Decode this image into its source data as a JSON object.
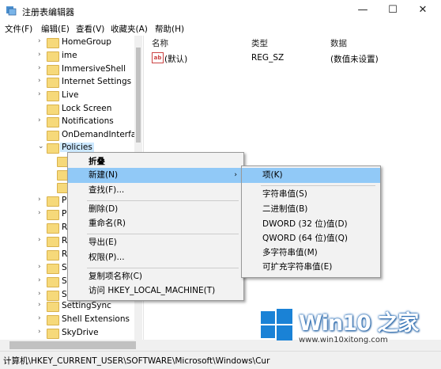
{
  "window": {
    "title": "注册表编辑器",
    "minimize": "—",
    "maximize": "☐",
    "close": "✕"
  },
  "menubar": [
    "文件(F)",
    "编辑(E)",
    "查看(V)",
    "收藏夹(A)",
    "帮助(H)"
  ],
  "tree": {
    "items": [
      {
        "label": "HomeGroup",
        "expanded": false
      },
      {
        "label": "ime",
        "expanded": false
      },
      {
        "label": "ImmersiveShell",
        "expanded": false
      },
      {
        "label": "Internet Settings",
        "expanded": false
      },
      {
        "label": "Live",
        "expanded": false
      },
      {
        "label": "Lock Screen",
        "expanded": false
      },
      {
        "label": "Notifications",
        "expanded": false
      },
      {
        "label": "OnDemandInterfac",
        "expanded": false
      },
      {
        "label": "Policies",
        "expanded": true
      },
      {
        "label": "",
        "expanded": false
      },
      {
        "label": "",
        "expanded": false
      },
      {
        "label": "P",
        "expanded": false
      },
      {
        "label": "P",
        "expanded": false
      },
      {
        "label": "R",
        "expanded": false
      },
      {
        "label": "R",
        "expanded": false
      },
      {
        "label": "R",
        "expanded": false
      },
      {
        "label": "S",
        "expanded": false
      },
      {
        "label": "S",
        "expanded": false
      },
      {
        "label": "S",
        "expanded": false
      },
      {
        "label": "SettingSync",
        "expanded": false
      },
      {
        "label": "Shell Extensions",
        "expanded": false
      },
      {
        "label": "SkyDrive",
        "expanded": false
      }
    ]
  },
  "list": {
    "headers": {
      "name": "名称",
      "type": "类型",
      "data": "数据"
    },
    "rows": [
      {
        "icon": "ab",
        "name": "(默认)",
        "type": "REG_SZ",
        "data": "(数值未设置)"
      }
    ]
  },
  "context_menu": {
    "items": [
      {
        "label": "折叠",
        "bold": true
      },
      {
        "label": "新建(N)",
        "highlight": true,
        "submenu": "›"
      },
      {
        "label": "查找(F)..."
      },
      {
        "label": "删除(D)"
      },
      {
        "label": "重命名(R)"
      },
      {
        "label": "导出(E)"
      },
      {
        "label": "权限(P)..."
      },
      {
        "label": "复制项名称(C)"
      },
      {
        "label": "访问 HKEY_LOCAL_MACHINE(T)"
      }
    ]
  },
  "submenu": {
    "items": [
      {
        "label": "项(K)",
        "highlight": true
      },
      {
        "label": "字符串值(S)"
      },
      {
        "label": "二进制值(B)"
      },
      {
        "label": "DWORD (32 位)值(D)"
      },
      {
        "label": "QWORD (64 位)值(Q)"
      },
      {
        "label": "多字符串值(M)"
      },
      {
        "label": "可扩充字符串值(E)"
      }
    ]
  },
  "statusbar": {
    "path": "计算机\\HKEY_CURRENT_USER\\SOFTWARE\\Microsoft\\Windows\\Cur"
  },
  "watermark": {
    "title": "Win10 之家",
    "url": "www.win10xitong.com"
  },
  "colors": {
    "accent": "#91c9f7",
    "logo_blue": "#1a82d6",
    "folder": "#f6d97a"
  }
}
